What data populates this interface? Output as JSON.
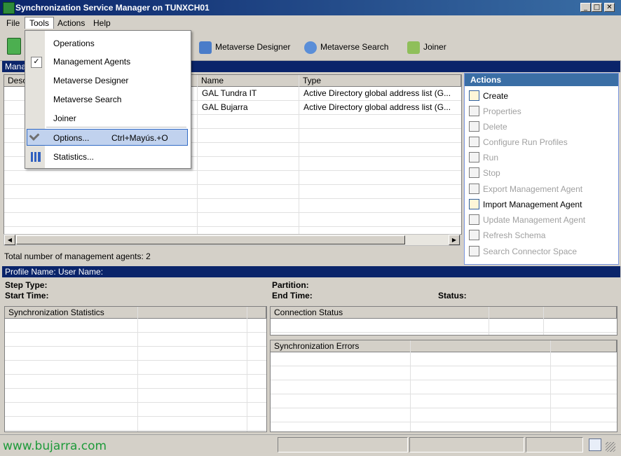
{
  "window": {
    "title": "Synchronization Service Manager on TUNXCH01"
  },
  "menubar": {
    "items": [
      "File",
      "Tools",
      "Actions",
      "Help"
    ]
  },
  "toolbar": {
    "buttons": [
      {
        "label": "Metaverse Designer",
        "icon": "metaverse-designer-icon"
      },
      {
        "label": "Metaverse Search",
        "icon": "metaverse-search-icon"
      },
      {
        "label": "Joiner",
        "icon": "joiner-icon"
      }
    ]
  },
  "tools_menu": {
    "items": [
      {
        "label": "Operations",
        "checked": false
      },
      {
        "label": "Management Agents",
        "checked": true
      },
      {
        "label": "Metaverse Designer",
        "checked": false
      },
      {
        "label": "Metaverse Search",
        "checked": false
      },
      {
        "label": "Joiner",
        "checked": false
      },
      {
        "label": "Options...",
        "shortcut": "Ctrl+Mayús.+O",
        "icon": "options-icon",
        "highlighted": true
      },
      {
        "label": "Statistics...",
        "icon": "statistics-icon"
      }
    ]
  },
  "management_agents": {
    "header_partial": "Mana",
    "columns": [
      "Desc",
      "Name",
      "Type"
    ],
    "rows": [
      {
        "name": "GAL Tundra IT",
        "type": "Active Directory global address list (G..."
      },
      {
        "name": "GAL Bujarra",
        "type": "Active Directory global address list (G..."
      }
    ],
    "total": "Total number of management agents: 2"
  },
  "actions": {
    "title": "Actions",
    "items": [
      {
        "label": "Create",
        "enabled": true
      },
      {
        "label": "Properties",
        "enabled": false
      },
      {
        "label": "Delete",
        "enabled": false
      },
      {
        "label": "Configure Run Profiles",
        "enabled": false
      },
      {
        "label": "Run",
        "enabled": false
      },
      {
        "label": "Stop",
        "enabled": false
      },
      {
        "label": "Export Management Agent",
        "enabled": false
      },
      {
        "label": "Import Management Agent",
        "enabled": true
      },
      {
        "label": "Update Management Agent",
        "enabled": false
      },
      {
        "label": "Refresh Schema",
        "enabled": false
      },
      {
        "label": "Search Connector Space",
        "enabled": false
      }
    ]
  },
  "profile": {
    "header": "Profile Name:  User Name:",
    "step_type": "Step Type:",
    "start_time": "Start Time:",
    "partition": "Partition:",
    "end_time": "End Time:",
    "status": "Status:"
  },
  "grids": {
    "sync_stats": "Synchronization Statistics",
    "connection_status": "Connection Status",
    "sync_errors": "Synchronization Errors"
  },
  "statusbar": {
    "watermark": "www.bujarra.com"
  },
  "colors": {
    "title_bar": "#0a246a",
    "accent": "#3a6ea5",
    "watermark": "#1e9a3a"
  }
}
